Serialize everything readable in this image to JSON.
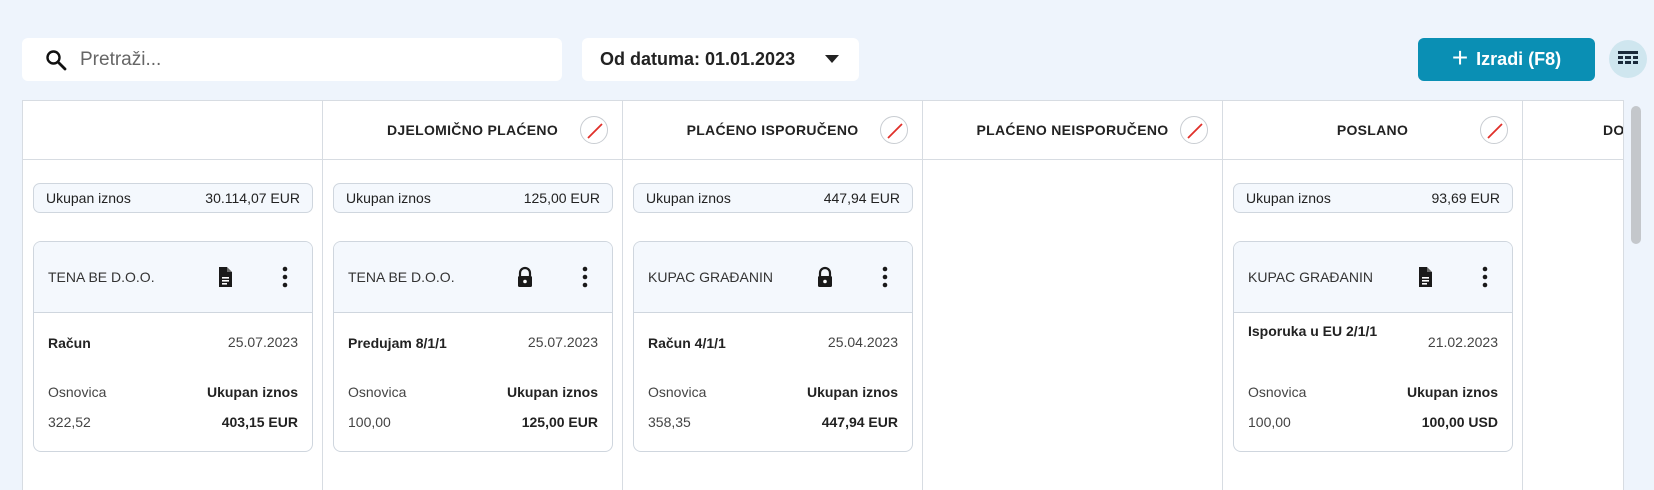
{
  "toolbar": {
    "search_placeholder": "Pretraži...",
    "date_filter": "Od datuma: 01.01.2023",
    "create_label": "Izradi (F8)",
    "accent_color": "#0a8fb4"
  },
  "columns": [
    {
      "title": "",
      "total_label": "Ukupan iznos",
      "total_value": "30.114,07 EUR",
      "card": {
        "customer": "TENA BE D.O.O.",
        "icon": "document-icon",
        "doc": "Račun",
        "date": "25.07.2023",
        "base_label": "Osnovica",
        "total_label": "Ukupan iznos",
        "base": "322,52",
        "total": "403,15 EUR"
      }
    },
    {
      "title": "DJELOMIČNO PLAĆENO",
      "total_label": "Ukupan iznos",
      "total_value": "125,00 EUR",
      "card": {
        "customer": "TENA BE D.O.O.",
        "icon": "lock-icon",
        "doc": "Predujam 8/1/1",
        "date": "25.07.2023",
        "base_label": "Osnovica",
        "total_label": "Ukupan iznos",
        "base": "100,00",
        "total": "125,00 EUR"
      }
    },
    {
      "title": "PLAĆENO ISPORUČENO",
      "total_label": "Ukupan iznos",
      "total_value": "447,94 EUR",
      "card": {
        "customer": "KUPAC GRAĐANIN",
        "icon": "lock-icon",
        "doc": "Račun 4/1/1",
        "date": "25.04.2023",
        "base_label": "Osnovica",
        "total_label": "Ukupan iznos",
        "base": "358,35",
        "total": "447,94 EUR"
      }
    },
    {
      "title": "PLAĆENO NEISPORUČENO"
    },
    {
      "title": "POSLANO",
      "total_label": "Ukupan iznos",
      "total_value": "93,69 EUR",
      "card": {
        "customer": "KUPAC GRAĐANIN",
        "icon": "document-icon",
        "doc": "Isporuka u EU 2/1/1",
        "date": "21.02.2023",
        "base_label": "Osnovica",
        "total_label": "Ukupan iznos",
        "base": "100,00",
        "total": "100,00 USD"
      }
    },
    {
      "title": "DOS"
    }
  ]
}
